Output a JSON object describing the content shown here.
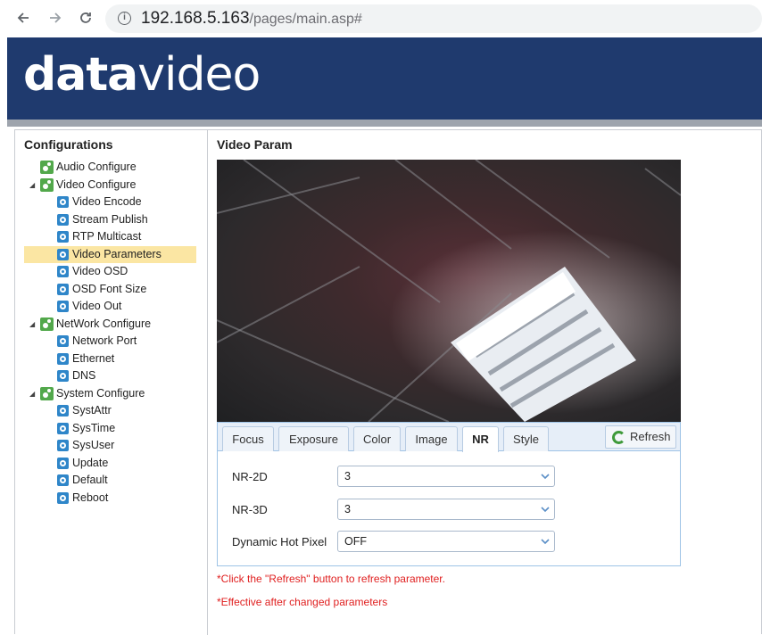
{
  "browser": {
    "back_icon": "arrow-left-icon",
    "forward_icon": "arrow-right-icon",
    "reload_icon": "reload-icon",
    "url_host": "192.168.5.163",
    "url_path": "/pages/main.asp#"
  },
  "header": {
    "logo_bold": "data",
    "logo_light": "video",
    "background": "#1f3a6e"
  },
  "sidebar": {
    "title": "Configurations",
    "items": [
      {
        "label": "Audio Configure",
        "level": 0,
        "icon": "gear-icon"
      },
      {
        "label": "Video Configure",
        "level": 0,
        "icon": "gear-icon",
        "expanded": true
      },
      {
        "label": "Video Encode",
        "level": 1,
        "icon": "page-icon"
      },
      {
        "label": "Stream Publish",
        "level": 1,
        "icon": "page-icon"
      },
      {
        "label": "RTP Multicast",
        "level": 1,
        "icon": "page-icon"
      },
      {
        "label": "Video Parameters",
        "level": 1,
        "icon": "page-icon",
        "selected": true
      },
      {
        "label": "Video OSD",
        "level": 1,
        "icon": "page-icon"
      },
      {
        "label": "OSD Font Size",
        "level": 1,
        "icon": "page-icon"
      },
      {
        "label": "Video Out",
        "level": 1,
        "icon": "page-icon"
      },
      {
        "label": "NetWork Configure",
        "level": 0,
        "icon": "gear-icon",
        "expanded": true
      },
      {
        "label": "Network Port",
        "level": 1,
        "icon": "page-icon"
      },
      {
        "label": "Ethernet",
        "level": 1,
        "icon": "page-icon"
      },
      {
        "label": "DNS",
        "level": 1,
        "icon": "page-icon"
      },
      {
        "label": "System Configure",
        "level": 0,
        "icon": "gear-icon",
        "expanded": true
      },
      {
        "label": "SystAttr",
        "level": 1,
        "icon": "page-icon"
      },
      {
        "label": "SysTime",
        "level": 1,
        "icon": "page-icon"
      },
      {
        "label": "SysUser",
        "level": 1,
        "icon": "page-icon"
      },
      {
        "label": "Update",
        "level": 1,
        "icon": "page-icon"
      },
      {
        "label": "Default",
        "level": 1,
        "icon": "page-icon"
      },
      {
        "label": "Reboot",
        "level": 1,
        "icon": "page-icon"
      }
    ]
  },
  "content": {
    "title": "Video Param",
    "tabs": [
      {
        "label": "Focus"
      },
      {
        "label": "Exposure"
      },
      {
        "label": "Color"
      },
      {
        "label": "Image"
      },
      {
        "label": "NR",
        "active": true
      },
      {
        "label": "Style"
      }
    ],
    "refresh_label": "Refresh",
    "params": [
      {
        "label": "NR-2D",
        "value": "3"
      },
      {
        "label": "NR-3D",
        "value": "3"
      },
      {
        "label": "Dynamic Hot Pixel",
        "value": "OFF"
      }
    ],
    "notes": [
      "*Click the \"Refresh\" button to refresh parameter.",
      "*Effective after changed parameters"
    ]
  }
}
